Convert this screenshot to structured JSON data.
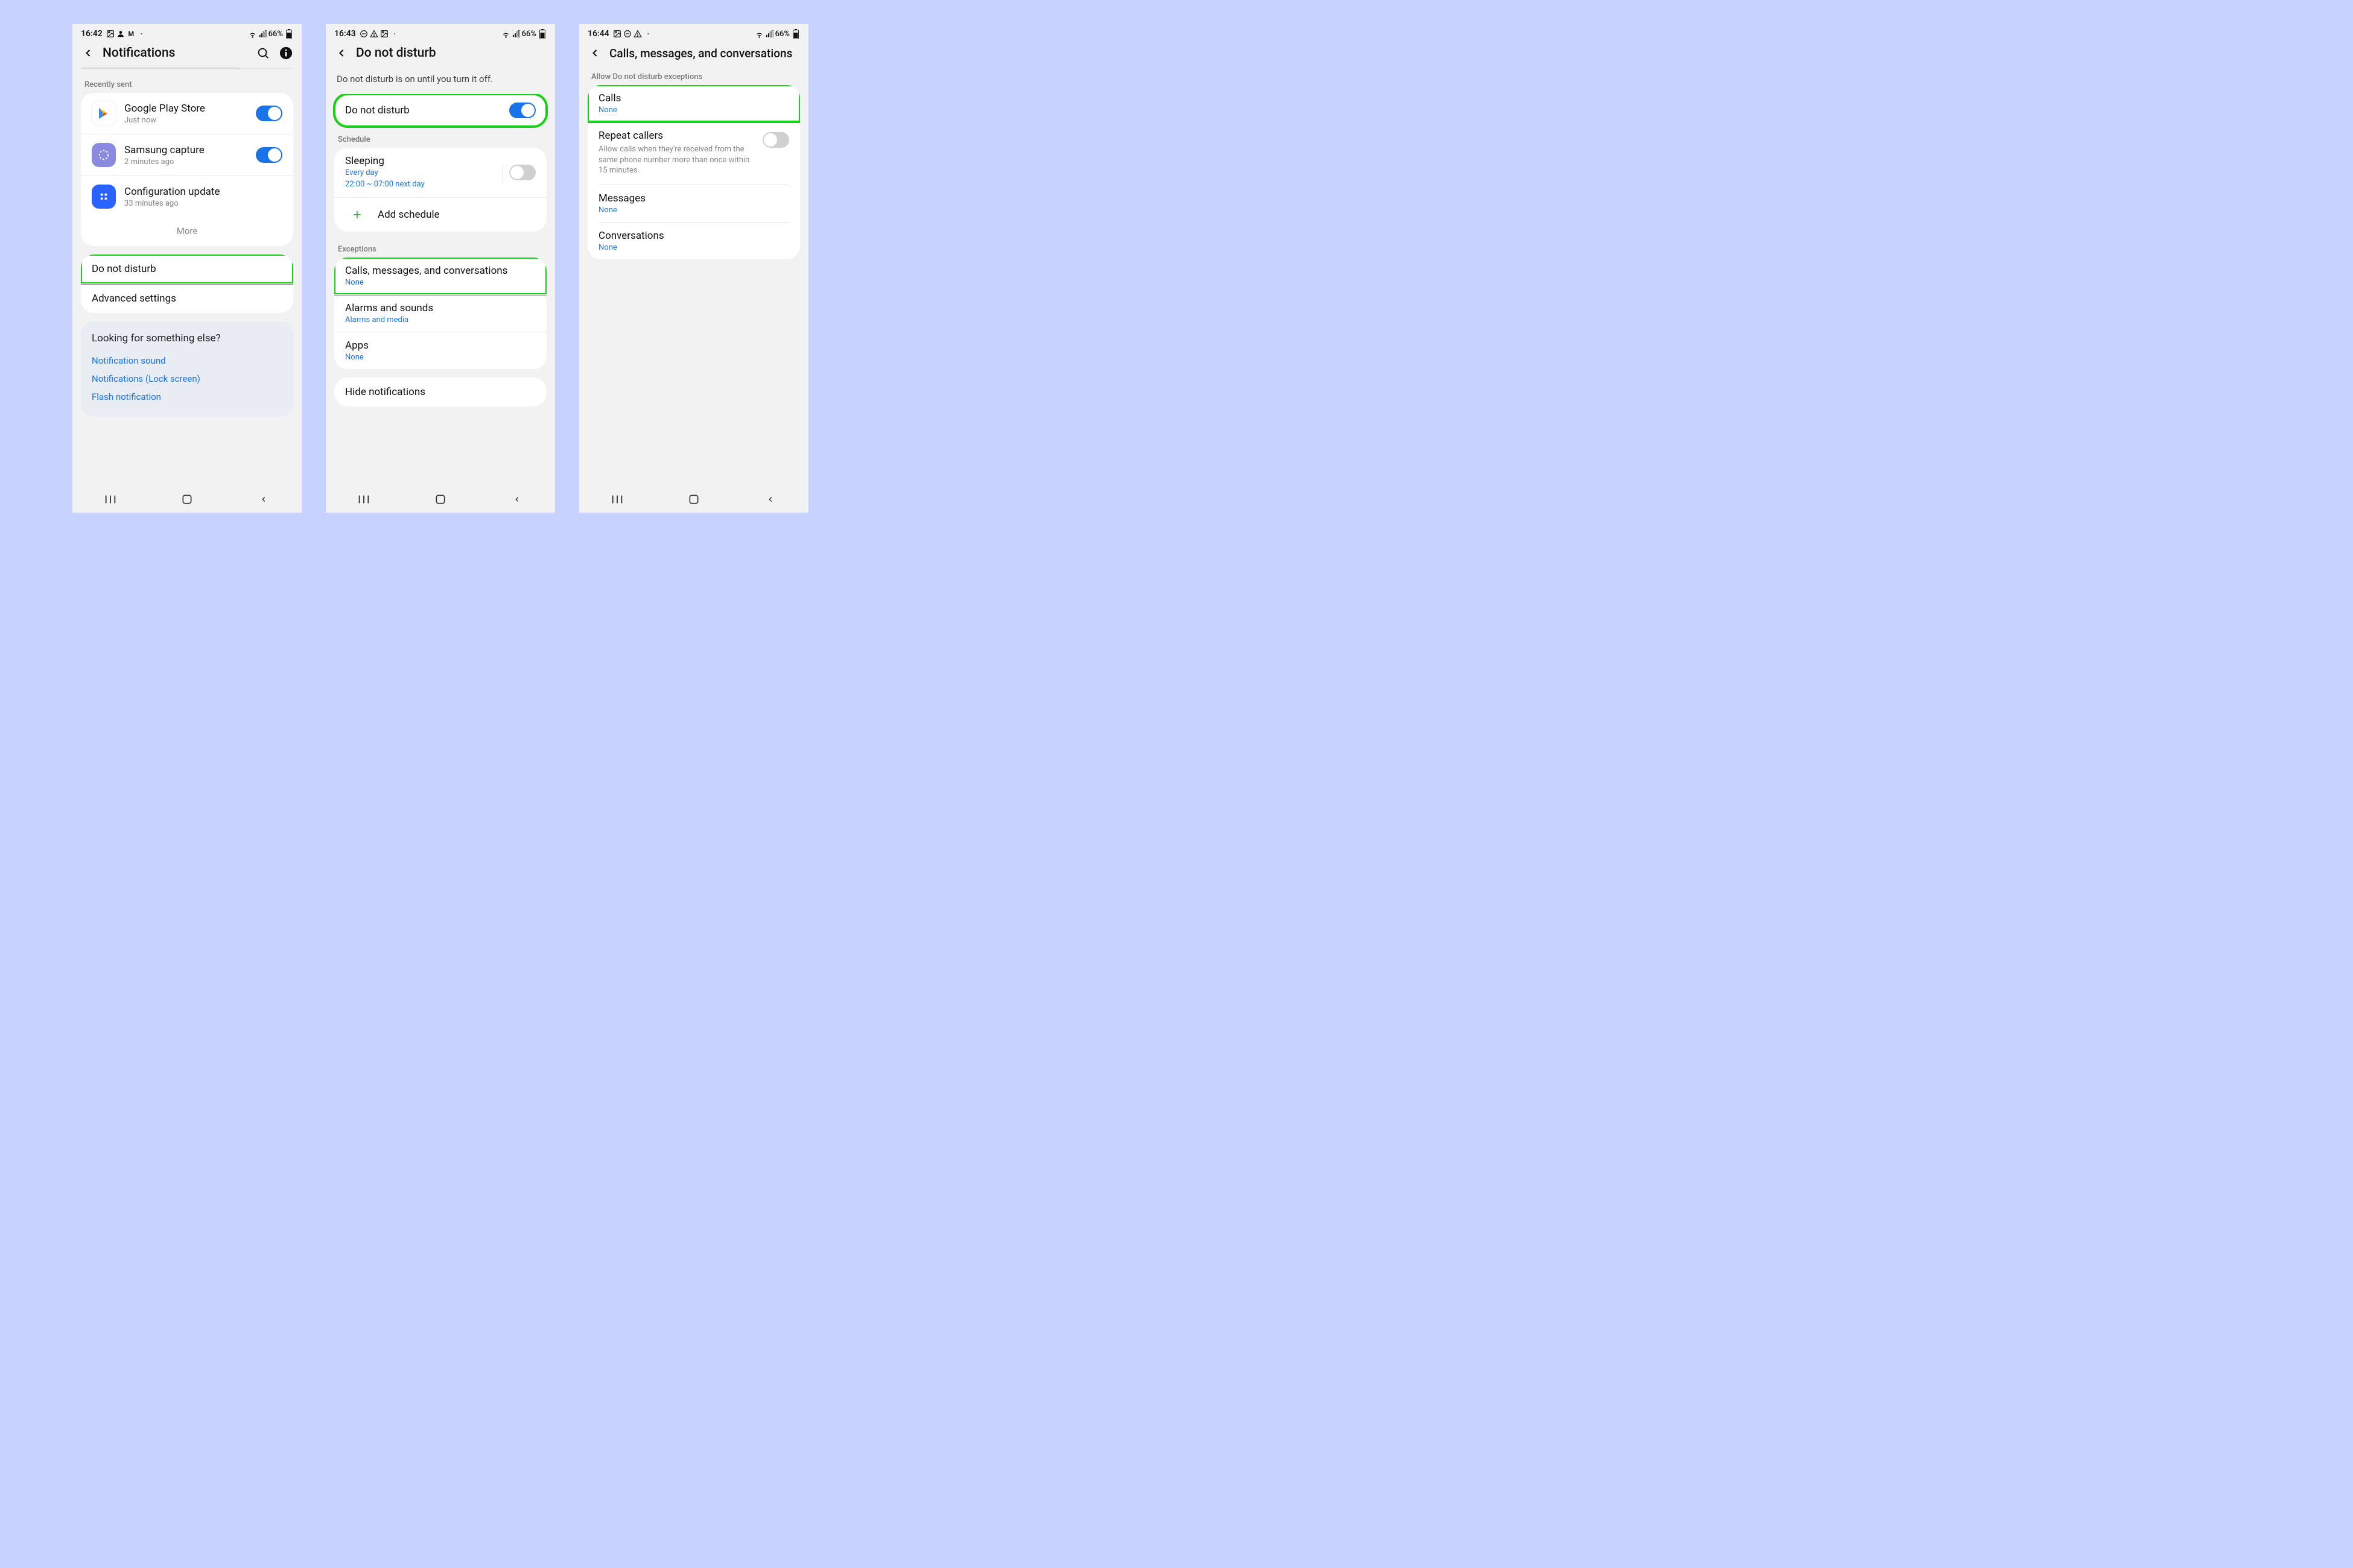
{
  "screens": [
    {
      "status": {
        "time": "16:42",
        "battery": "66%"
      },
      "title": "Notifications",
      "recently_sent_label": "Recently sent",
      "apps": [
        {
          "name": "Google Play Store",
          "sub": "Just now",
          "on": true
        },
        {
          "name": "Samsung capture",
          "sub": "2 minutes ago",
          "on": true
        },
        {
          "name": "Configuration update",
          "sub": "33 minutes ago",
          "on": null
        }
      ],
      "more": "More",
      "dnd": "Do not disturb",
      "advanced": "Advanced settings",
      "looking": {
        "heading": "Looking for something else?",
        "links": [
          "Notification sound",
          "Notifications (Lock screen)",
          "Flash notification"
        ]
      }
    },
    {
      "status": {
        "time": "16:43",
        "battery": "66%"
      },
      "title": "Do not disturb",
      "subtitle": "Do not disturb is on until you turn it off.",
      "dnd_toggle_label": "Do not disturb",
      "schedule_label": "Schedule",
      "sleeping": {
        "label": "Sleeping",
        "sub1": "Every day",
        "sub2": "22:00 ~ 07:00 next day"
      },
      "add_schedule": "Add schedule",
      "exceptions_label": "Exceptions",
      "exceptions": [
        {
          "label": "Calls, messages, and conversations",
          "sub": "None"
        },
        {
          "label": "Alarms and sounds",
          "sub": "Alarms and media"
        },
        {
          "label": "Apps",
          "sub": "None"
        }
      ],
      "hide": "Hide notifications"
    },
    {
      "status": {
        "time": "16:44",
        "battery": "66%"
      },
      "title": "Calls, messages, and conversations",
      "allow_label": "Allow Do not disturb exceptions",
      "items": [
        {
          "label": "Calls",
          "sub": "None"
        }
      ],
      "repeat": {
        "label": "Repeat callers",
        "desc": "Allow calls when they're received from the same phone number more than once within 15 minutes."
      },
      "more_items": [
        {
          "label": "Messages",
          "sub": "None"
        },
        {
          "label": "Conversations",
          "sub": "None"
        }
      ]
    }
  ]
}
